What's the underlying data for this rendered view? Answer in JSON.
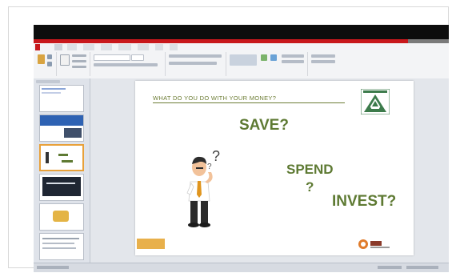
{
  "slide": {
    "heading": "WHAT DO YOU DO WITH YOUR MONEY?",
    "words": {
      "save": "SAVE?",
      "spend": "SPEND",
      "question": "?",
      "invest": "INVEST?"
    }
  },
  "colors": {
    "accent_red": "#c8181c",
    "slide_green": "#5e7a33",
    "highlight_orange": "#e8a13a"
  },
  "icons": [
    "logo-icon",
    "thinking-man-icon",
    "company-logo-icon"
  ]
}
